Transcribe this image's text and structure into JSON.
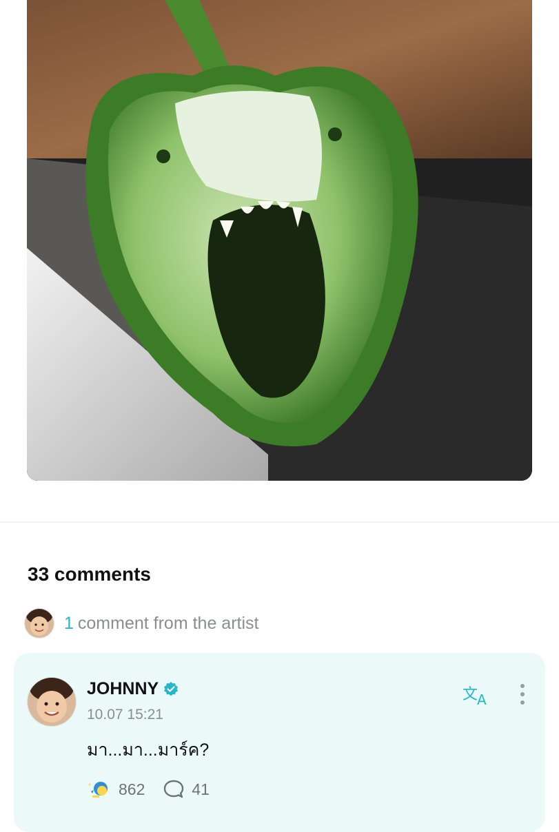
{
  "post": {
    "image_icon": "green-bell-pepper-screaming-face-photo"
  },
  "comments": {
    "count_label": "33 comments",
    "artist_count": "1",
    "artist_label": "comment from the artist"
  },
  "comment": {
    "author": "JOHNNY",
    "verified_icon": "verified-badge-icon",
    "timestamp": "10.07 15:21",
    "text": "มา...มา...มาร์ค?",
    "like_count": "862",
    "reply_count": "41",
    "colors": {
      "accent": "#22b8c8",
      "card_bg": "#ebfaf8",
      "muted_text": "#8a8d91"
    }
  }
}
